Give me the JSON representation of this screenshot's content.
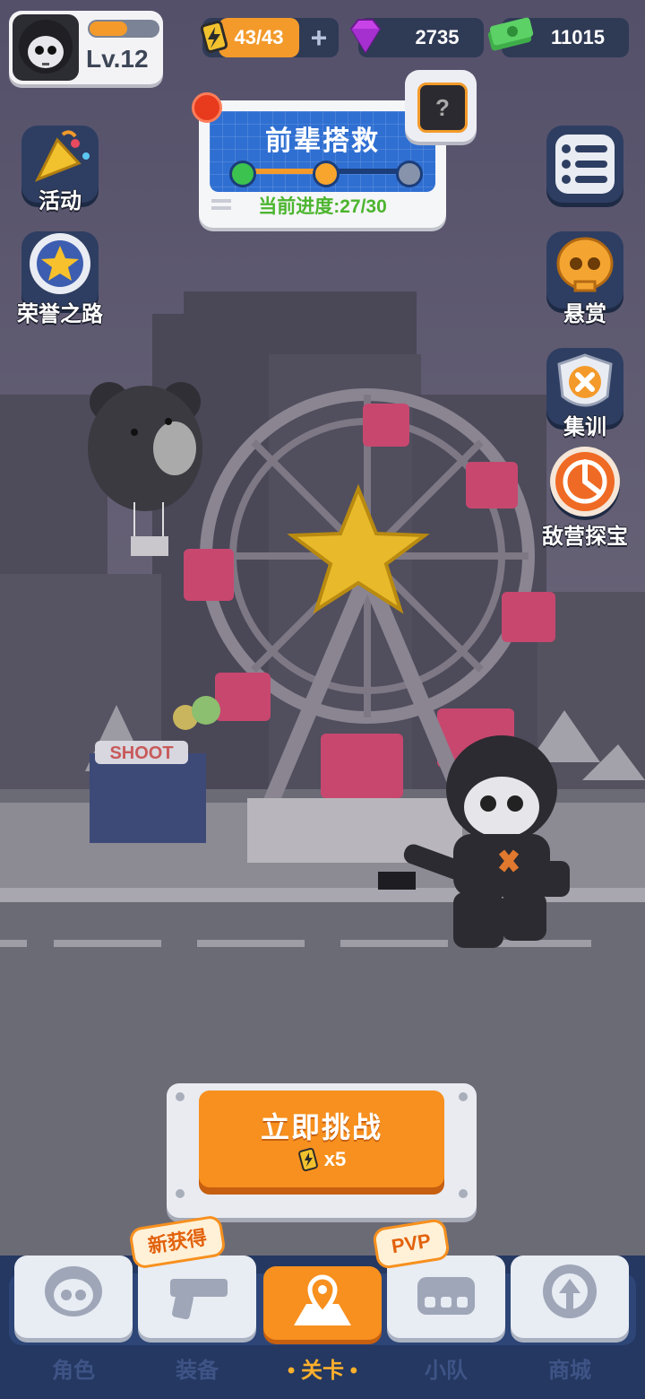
{
  "player": {
    "level": "Lv.12",
    "xp_fraction": 0.55
  },
  "resources": {
    "energy": "43/43",
    "gems": "2735",
    "cash": "11015"
  },
  "mission": {
    "title": "前辈搭救",
    "progress_text": "当前进度:27/30",
    "stage_active": 2,
    "stage_total": 3
  },
  "left_menu": [
    {
      "label": "活动",
      "icon": "party-popper-icon"
    },
    {
      "label": "荣誉之路",
      "icon": "star-medal-icon"
    }
  ],
  "right_menu": [
    {
      "label": "悬赏",
      "icon": "skull-icon"
    },
    {
      "label": "集训",
      "icon": "badge-x-icon"
    },
    {
      "label": "敌营探宝",
      "icon": "radar-icon"
    }
  ],
  "challenge": {
    "label": "立即挑战",
    "cost": "x5"
  },
  "nav": {
    "tabs": [
      {
        "label": "角色",
        "icon": "skull-face-icon"
      },
      {
        "label": "装备",
        "icon": "pistol-icon"
      },
      {
        "label": "关卡",
        "icon": "map-pin-icon"
      },
      {
        "label": "小队",
        "icon": "squad-icon"
      },
      {
        "label": "商城",
        "icon": "shop-icon"
      }
    ],
    "active_index": 2,
    "badges": {
      "equipment": "新获得",
      "squad": "PVP"
    }
  },
  "colors": {
    "accent": "#f7901e",
    "panel": "#2f3a55",
    "mission_blue": "#2f6fd2",
    "progress_green": "#4cb52e"
  }
}
